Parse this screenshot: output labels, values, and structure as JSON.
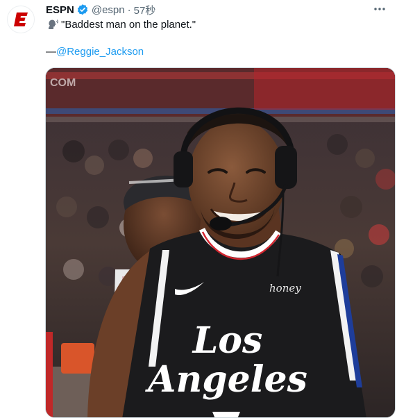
{
  "tweet": {
    "display_name": "ESPN",
    "handle": "@espn",
    "separator": "·",
    "time": "57秒",
    "emoji": "speaking-head-emoji",
    "quote": "\"Baddest man on the planet.\"",
    "attribution_dash": "—",
    "mention": "@Reggie_Jackson"
  },
  "media": {
    "jersey_wordmark_top": "Los",
    "jersey_wordmark_bottom": "Angeles",
    "jersey_patch": "honey",
    "arena_sign": "COM"
  },
  "colors": {
    "brand_red": "#cc0000",
    "verified_blue": "#1d9bf0",
    "link_blue": "#1d9bf0",
    "muted_text": "#536471",
    "jersey_black": "#1b1b1d"
  },
  "icons": {
    "avatar": "espn-logo",
    "verified": "verified-badge-icon",
    "more": "more-options-icon"
  }
}
